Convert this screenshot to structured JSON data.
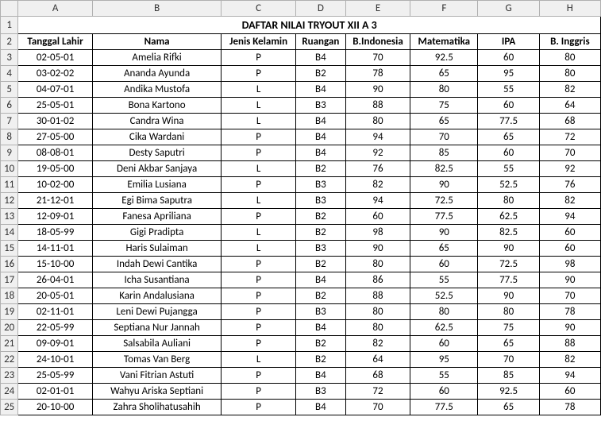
{
  "columns": [
    "A",
    "B",
    "C",
    "D",
    "E",
    "F",
    "G",
    "H"
  ],
  "title": "DAFTAR NILAI TRYOUT XII A 3",
  "headers": {
    "tanggal_lahir": "Tanggal Lahir",
    "nama": "Nama",
    "jenis_kelamin": "Jenis Kelamin",
    "ruangan": "Ruangan",
    "bindo": "B.Indonesia",
    "matematika": "Matematika",
    "ipa": "IPA",
    "binggris": "B. Inggris"
  },
  "rows": [
    {
      "tgl": "02-05-01",
      "nama": "Amelia Rifki",
      "jk": "P",
      "ruang": "B4",
      "bindo": "70",
      "mtk": "92.5",
      "ipa": "60",
      "bing": "80"
    },
    {
      "tgl": "03-02-02",
      "nama": "Ananda Ayunda",
      "jk": "P",
      "ruang": "B2",
      "bindo": "78",
      "mtk": "65",
      "ipa": "95",
      "bing": "80"
    },
    {
      "tgl": "04-07-01",
      "nama": "Andika Mustofa",
      "jk": "L",
      "ruang": "B4",
      "bindo": "90",
      "mtk": "80",
      "ipa": "55",
      "bing": "82"
    },
    {
      "tgl": "25-05-01",
      "nama": "Bona Kartono",
      "jk": "L",
      "ruang": "B3",
      "bindo": "88",
      "mtk": "75",
      "ipa": "60",
      "bing": "64"
    },
    {
      "tgl": "30-01-02",
      "nama": "Candra Wina",
      "jk": "L",
      "ruang": "B4",
      "bindo": "80",
      "mtk": "65",
      "ipa": "77.5",
      "bing": "68"
    },
    {
      "tgl": "27-05-00",
      "nama": "Cika Wardani",
      "jk": "P",
      "ruang": "B4",
      "bindo": "94",
      "mtk": "70",
      "ipa": "65",
      "bing": "72"
    },
    {
      "tgl": "08-08-01",
      "nama": "Desty Saputri",
      "jk": "P",
      "ruang": "B4",
      "bindo": "92",
      "mtk": "85",
      "ipa": "60",
      "bing": "70"
    },
    {
      "tgl": "19-05-00",
      "nama": "Deni Akbar Sanjaya",
      "jk": "L",
      "ruang": "B2",
      "bindo": "76",
      "mtk": "82.5",
      "ipa": "55",
      "bing": "92"
    },
    {
      "tgl": "10-02-00",
      "nama": "Emilia Lusiana",
      "jk": "P",
      "ruang": "B3",
      "bindo": "82",
      "mtk": "90",
      "ipa": "52.5",
      "bing": "76"
    },
    {
      "tgl": "21-12-01",
      "nama": "Egi Bima Saputra",
      "jk": "L",
      "ruang": "B3",
      "bindo": "94",
      "mtk": "72.5",
      "ipa": "80",
      "bing": "82"
    },
    {
      "tgl": "12-09-01",
      "nama": "Fanesa Apriliana",
      "jk": "P",
      "ruang": "B2",
      "bindo": "60",
      "mtk": "77.5",
      "ipa": "62.5",
      "bing": "94"
    },
    {
      "tgl": "18-05-99",
      "nama": "Gigi Pradipta",
      "jk": "L",
      "ruang": "B2",
      "bindo": "98",
      "mtk": "90",
      "ipa": "82.5",
      "bing": "60"
    },
    {
      "tgl": "14-11-01",
      "nama": "Haris Sulaiman",
      "jk": "L",
      "ruang": "B3",
      "bindo": "90",
      "mtk": "65",
      "ipa": "90",
      "bing": "60"
    },
    {
      "tgl": "15-10-00",
      "nama": "Indah Dewi Cantika",
      "jk": "P",
      "ruang": "B2",
      "bindo": "80",
      "mtk": "60",
      "ipa": "72.5",
      "bing": "98"
    },
    {
      "tgl": "26-04-01",
      "nama": "Icha Susantiana",
      "jk": "P",
      "ruang": "B4",
      "bindo": "86",
      "mtk": "55",
      "ipa": "77.5",
      "bing": "90"
    },
    {
      "tgl": "20-05-01",
      "nama": "Karin Andalusiana",
      "jk": "P",
      "ruang": "B2",
      "bindo": "88",
      "mtk": "52.5",
      "ipa": "90",
      "bing": "70"
    },
    {
      "tgl": "02-11-01",
      "nama": "Leni Dewi Pujangga",
      "jk": "P",
      "ruang": "B3",
      "bindo": "80",
      "mtk": "80",
      "ipa": "80",
      "bing": "78"
    },
    {
      "tgl": "22-05-99",
      "nama": "Septiana Nur Jannah",
      "jk": "P",
      "ruang": "B4",
      "bindo": "80",
      "mtk": "62.5",
      "ipa": "75",
      "bing": "90"
    },
    {
      "tgl": "09-09-01",
      "nama": "Salsabila Auliani",
      "jk": "P",
      "ruang": "B2",
      "bindo": "82",
      "mtk": "60",
      "ipa": "65",
      "bing": "88"
    },
    {
      "tgl": "24-10-01",
      "nama": "Tomas Van Berg",
      "jk": "L",
      "ruang": "B2",
      "bindo": "64",
      "mtk": "95",
      "ipa": "70",
      "bing": "82"
    },
    {
      "tgl": "25-05-99",
      "nama": "Vani Fitrian Astuti",
      "jk": "P",
      "ruang": "B4",
      "bindo": "68",
      "mtk": "55",
      "ipa": "85",
      "bing": "94"
    },
    {
      "tgl": "02-01-01",
      "nama": "Wahyu Ariska Septiani",
      "jk": "P",
      "ruang": "B3",
      "bindo": "72",
      "mtk": "60",
      "ipa": "92.5",
      "bing": "60"
    },
    {
      "tgl": "20-10-00",
      "nama": "Zahra Sholihatusahih",
      "jk": "P",
      "ruang": "B4",
      "bindo": "70",
      "mtk": "77.5",
      "ipa": "65",
      "bing": "78"
    }
  ]
}
